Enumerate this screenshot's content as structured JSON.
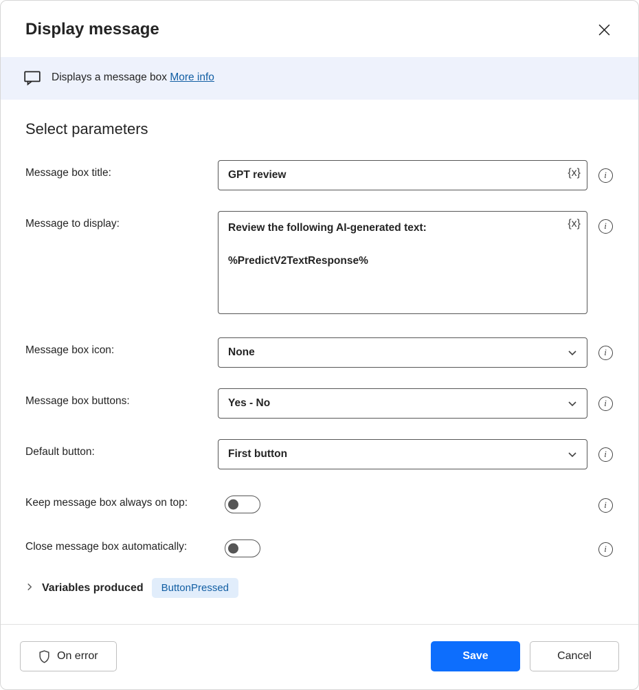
{
  "header": {
    "title": "Display message"
  },
  "banner": {
    "text": "Displays a message box ",
    "link": "More info"
  },
  "section_title": "Select parameters",
  "fields": {
    "title": {
      "label": "Message box title:",
      "value": "GPT review"
    },
    "message": {
      "label": "Message to display:",
      "value": "Review the following AI-generated text:\n\n%PredictV2TextResponse%"
    },
    "icon": {
      "label": "Message box icon:",
      "value": "None"
    },
    "buttons": {
      "label": "Message box buttons:",
      "value": "Yes - No"
    },
    "default_button": {
      "label": "Default button:",
      "value": "First button"
    },
    "always_on_top": {
      "label": "Keep message box always on top:",
      "value": false
    },
    "auto_close": {
      "label": "Close message box automatically:",
      "value": false
    }
  },
  "variables": {
    "label": "Variables produced",
    "items": [
      "ButtonPressed"
    ]
  },
  "footer": {
    "on_error": "On error",
    "save": "Save",
    "cancel": "Cancel"
  }
}
